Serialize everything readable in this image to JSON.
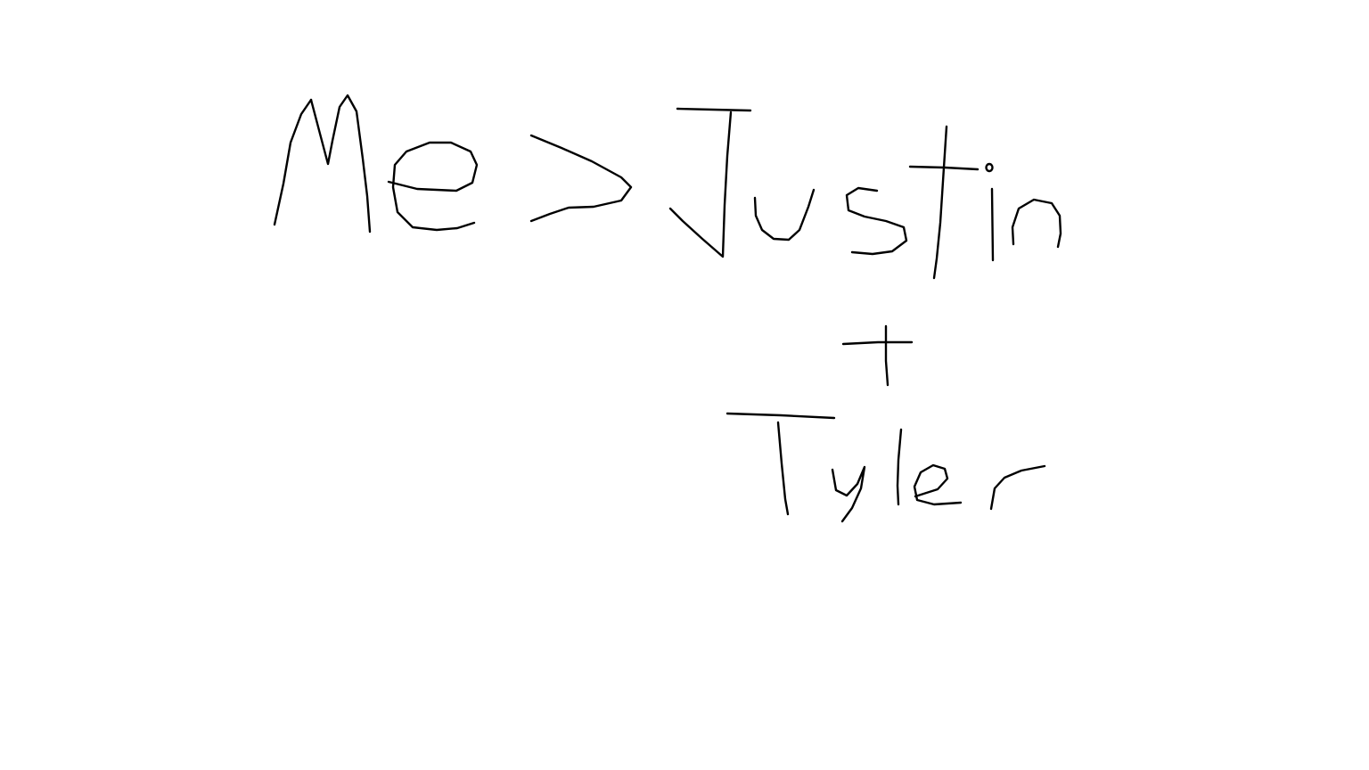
{
  "drawing": {
    "line1": "Me > Justin",
    "line2": "+",
    "line3": "Tyler",
    "ink_color": "#000000",
    "background_color": "#ffffff"
  }
}
